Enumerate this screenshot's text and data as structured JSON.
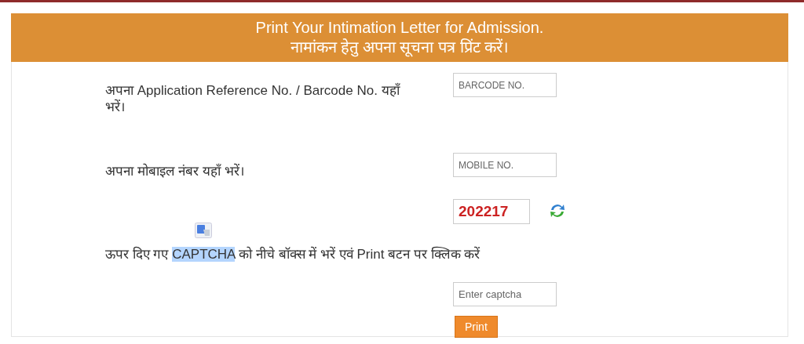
{
  "header": {
    "title": "Print Your Intimation Letter for Admission.",
    "subtitle": "नामांकन हेतु अपना सूचना पत्र प्रिंट करें।"
  },
  "fields": [
    {
      "label": "अपना Application Reference No. / Barcode No. यहाँ भरें।",
      "placeholder": "BARCODE NO."
    },
    {
      "label": "अपना मोबाइल नंबर यहाँ भरें।",
      "placeholder": "MOBILE NO."
    }
  ],
  "captcha": {
    "code": "202217"
  },
  "instruction": {
    "text_before": "ऊपर दिए गए ",
    "selected_text": "CAPTCHA",
    "text_after": " को नीचे बॉक्स में भरें एवं Print बटन पर क्लिक करें"
  },
  "captcha_input": {
    "placeholder": "Enter captcha"
  },
  "print_button": "Print"
}
